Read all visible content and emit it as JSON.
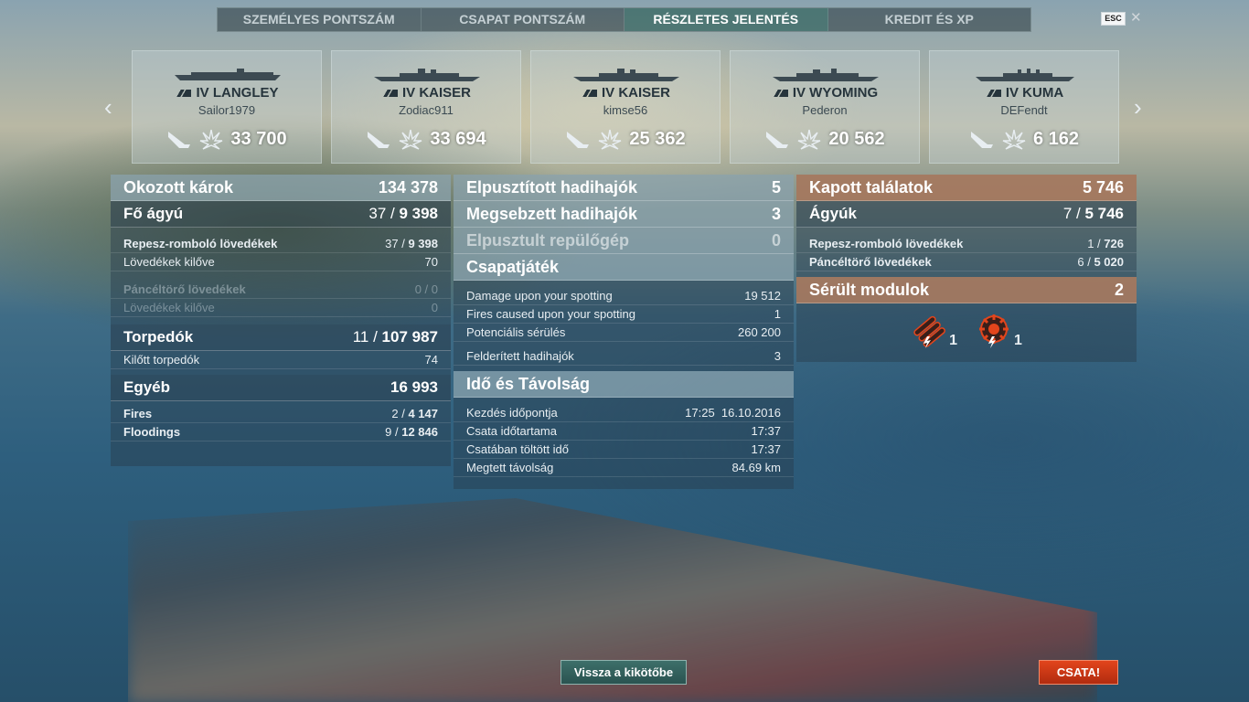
{
  "tabs": [
    {
      "label": "SZEMÉLYES PONTSZÁM"
    },
    {
      "label": "CSAPAT PONTSZÁM"
    },
    {
      "label": "RÉSZLETES JELENTÉS"
    },
    {
      "label": "KREDIT ÉS XP"
    }
  ],
  "esc_label": "ESC",
  "close_glyph": "✕",
  "nav": {
    "prev": "‹",
    "next": "›"
  },
  "cards": [
    {
      "tier": "IV",
      "ship": "LANGLEY",
      "player": "Sailor1979",
      "score": "33 700"
    },
    {
      "tier": "IV",
      "ship": "KAISER",
      "player": "Zodiac911",
      "score": "33 694"
    },
    {
      "tier": "IV",
      "ship": "KAISER",
      "player": "kimse56",
      "score": "25 362"
    },
    {
      "tier": "IV",
      "ship": "WYOMING",
      "player": "Pederon",
      "score": "20 562"
    },
    {
      "tier": "IV",
      "ship": "KUMA",
      "player": "DEFendt",
      "score": "6 162"
    }
  ],
  "damage": {
    "title": "Okozott károk",
    "total": "134 378",
    "main": {
      "label": "Fő ágyú",
      "hits": "37 /",
      "dmg": "9 398"
    },
    "he": {
      "label": "Repesz-romboló lövedékek",
      "hits": "37 /",
      "dmg": "9 398"
    },
    "he_fired": {
      "label": "Lövedékek kilőve",
      "value": "70"
    },
    "ap": {
      "label": "Páncéltörő lövedékek",
      "value": "0 / 0"
    },
    "ap_fired": {
      "label": "Lövedékek kilőve",
      "value": "0"
    },
    "torp": {
      "label": "Torpedók",
      "hits": "11 /",
      "dmg": "107 987"
    },
    "torp_fired": {
      "label": "Kilőtt torpedók",
      "value": "74"
    },
    "other": {
      "label": "Egyéb",
      "value": "16 993"
    },
    "fires": {
      "label": "Fires",
      "hits": "2 /",
      "dmg": "4 147"
    },
    "floods": {
      "label": "Floodings",
      "hits": "9 /",
      "dmg": "12 846"
    }
  },
  "middle": {
    "destroyed": {
      "label": "Elpusztított hadihajók",
      "value": "5"
    },
    "damaged": {
      "label": "Megsebzett hadihajók",
      "value": "3"
    },
    "planes": {
      "label": "Elpusztult repülőgép",
      "value": "0"
    },
    "team": {
      "title": "Csapatjáték",
      "rows": [
        {
          "label": "Damage upon your spotting",
          "value": "19 512"
        },
        {
          "label": "Fires caused upon your spotting",
          "value": "1"
        },
        {
          "label": "Potenciális sérülés",
          "value": "260 200"
        },
        {
          "label": "Felderített hadihajók",
          "value": "3"
        }
      ]
    },
    "time": {
      "title": "Idő és Távolság",
      "rows": [
        {
          "label": "Kezdés időpontja",
          "value": "17:25  16.10.2016"
        },
        {
          "label": "Csata időtartama",
          "value": "17:37"
        },
        {
          "label": "Csatában töltött idő",
          "value": "17:37"
        },
        {
          "label": "Megtett távolság",
          "value": "84.69 km"
        }
      ]
    }
  },
  "received": {
    "title": "Kapott találatok",
    "total": "5 746",
    "guns": {
      "label": "Ágyúk",
      "hits": "7 /",
      "dmg": "5 746"
    },
    "he": {
      "label": "Repesz-romboló lövedékek",
      "hits": "1 /",
      "dmg": "726"
    },
    "ap": {
      "label": "Páncéltörő lövedékek",
      "hits": "6 /",
      "dmg": "5 020"
    },
    "modules": {
      "title": "Sérült modulok",
      "value": "2",
      "items": [
        {
          "icon": "torpedo-tubes-icon",
          "count": "1"
        },
        {
          "icon": "engine-module-icon",
          "count": "1"
        }
      ]
    }
  },
  "buttons": {
    "port": "Vissza a kikötőbe",
    "battle": "CSATA!"
  },
  "colors": {
    "accent_orange": "#e2451c",
    "active_tab": "#3d8278",
    "received_header": "#af7d5f"
  }
}
